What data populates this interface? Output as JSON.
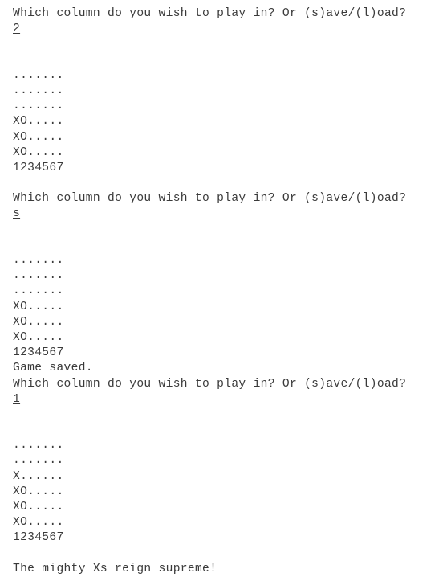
{
  "terminal": {
    "prompt_text": "Which column do you wish to play in? Or (s)ave/(l)oad?",
    "save_confirm_text": "Game saved.",
    "win_text": "The mighty Xs reign supreme!",
    "column_legend": "1234567",
    "empty_cell": ".",
    "player_x": "X",
    "player_o": "O",
    "colors": {
      "background": "#ffffff",
      "text": "#3a3a3a"
    },
    "inputs": {
      "first": "2",
      "second": "s",
      "third": "1"
    },
    "boards": [
      {
        "rows": [
          ".......",
          ".......",
          ".......",
          "XO.....",
          "XO.....",
          "XO....."
        ],
        "legend": "1234567"
      },
      {
        "rows": [
          ".......",
          ".......",
          ".......",
          "XO.....",
          "XO.....",
          "XO....."
        ],
        "legend": "1234567"
      },
      {
        "rows": [
          ".......",
          ".......",
          "X......",
          "XO.....",
          "XO.....",
          "XO....."
        ],
        "legend": "1234567"
      }
    ],
    "transcript": [
      {
        "kind": "prompt",
        "text": "Which column do you wish to play in? Or (s)ave/(l)oad?"
      },
      {
        "kind": "input",
        "text": "2"
      },
      {
        "kind": "blank",
        "text": ""
      },
      {
        "kind": "blank",
        "text": ""
      },
      {
        "kind": "board-row",
        "text": "......."
      },
      {
        "kind": "board-row",
        "text": "......."
      },
      {
        "kind": "board-row",
        "text": "......."
      },
      {
        "kind": "board-row",
        "text": "XO....."
      },
      {
        "kind": "board-row",
        "text": "XO....."
      },
      {
        "kind": "board-row",
        "text": "XO....."
      },
      {
        "kind": "legend",
        "text": "1234567"
      },
      {
        "kind": "blank",
        "text": ""
      },
      {
        "kind": "prompt",
        "text": "Which column do you wish to play in? Or (s)ave/(l)oad?"
      },
      {
        "kind": "input",
        "text": "s"
      },
      {
        "kind": "blank",
        "text": ""
      },
      {
        "kind": "blank",
        "text": ""
      },
      {
        "kind": "board-row",
        "text": "......."
      },
      {
        "kind": "board-row",
        "text": "......."
      },
      {
        "kind": "board-row",
        "text": "......."
      },
      {
        "kind": "board-row",
        "text": "XO....."
      },
      {
        "kind": "board-row",
        "text": "XO....."
      },
      {
        "kind": "board-row",
        "text": "XO....."
      },
      {
        "kind": "legend",
        "text": "1234567"
      },
      {
        "kind": "status",
        "text": "Game saved."
      },
      {
        "kind": "prompt",
        "text": "Which column do you wish to play in? Or (s)ave/(l)oad?"
      },
      {
        "kind": "input",
        "text": "1"
      },
      {
        "kind": "blank",
        "text": ""
      },
      {
        "kind": "blank",
        "text": ""
      },
      {
        "kind": "board-row",
        "text": "......."
      },
      {
        "kind": "board-row",
        "text": "......."
      },
      {
        "kind": "board-row",
        "text": "X......"
      },
      {
        "kind": "board-row",
        "text": "XO....."
      },
      {
        "kind": "board-row",
        "text": "XO....."
      },
      {
        "kind": "board-row",
        "text": "XO....."
      },
      {
        "kind": "legend",
        "text": "1234567"
      },
      {
        "kind": "blank",
        "text": ""
      },
      {
        "kind": "win",
        "text": "The mighty Xs reign supreme!"
      }
    ]
  }
}
